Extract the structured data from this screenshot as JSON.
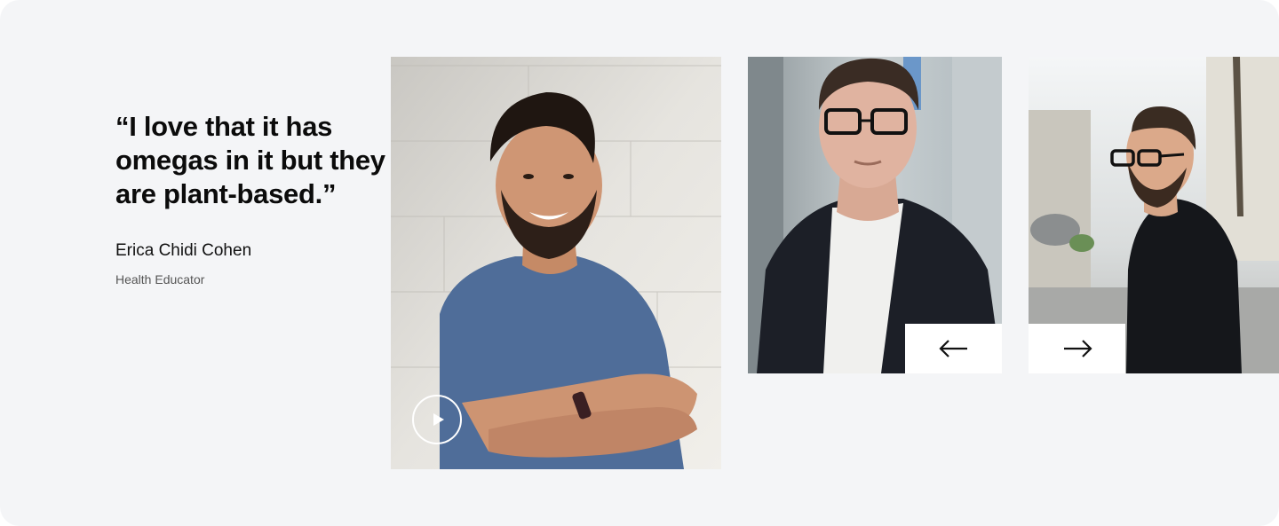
{
  "testimonial": {
    "quote": "“I love that it has omegas in it but they are plant-based.”",
    "author_name": "Erica Chidi Cohen",
    "author_role": "Health Educator"
  },
  "gallery": {
    "photos": [
      {
        "icon": "portrait-smiling-man-blue-tshirt"
      },
      {
        "icon": "portrait-man-glasses-blazer"
      },
      {
        "icon": "portrait-man-glasses-turtleneck"
      }
    ],
    "play_icon": "play-icon",
    "prev_icon": "arrow-left-icon",
    "next_icon": "arrow-right-icon"
  },
  "colors": {
    "background": "#f4f5f7",
    "text": "#0b0b0b",
    "muted": "#555555"
  }
}
